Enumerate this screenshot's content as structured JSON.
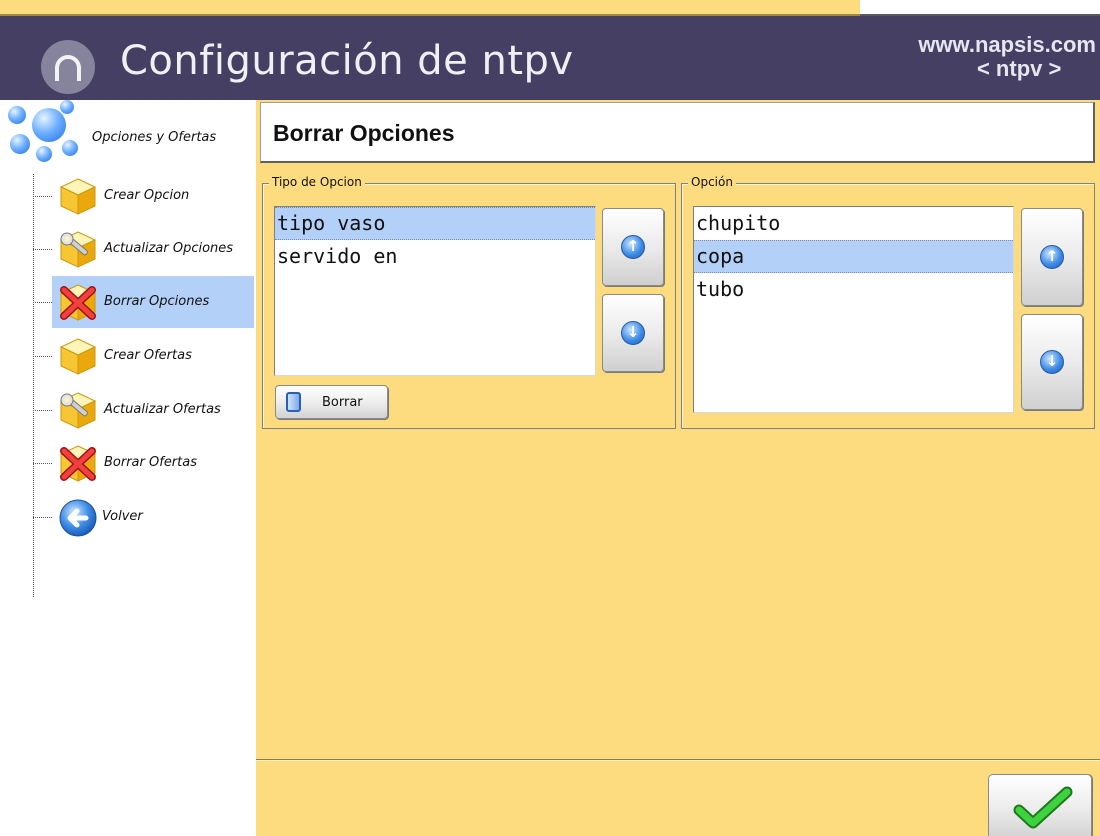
{
  "header": {
    "title": "Configuración de ntpv",
    "site_url": "www.napsis.com",
    "site_sub": "< ntpv >",
    "logo_icon": "ntpv-logo-icon",
    "colors": {
      "header_bg": "#453f63",
      "panel_bg": "#fddc80",
      "selection": "#b2d0f8"
    }
  },
  "sidebar": {
    "root_label": "Opciones y Ofertas",
    "root_icon": "bubbles-icon",
    "items": [
      {
        "label": "Crear Opcion",
        "icon": "cube-icon",
        "selected": false
      },
      {
        "label": "Actualizar Opciones",
        "icon": "wrench-cube-icon",
        "selected": false
      },
      {
        "label": "Borrar Opciones",
        "icon": "delete-cube-icon",
        "selected": true
      },
      {
        "label": "Crear Ofertas",
        "icon": "cube-icon",
        "selected": false
      },
      {
        "label": "Actualizar Ofertas",
        "icon": "wrench-cube-icon",
        "selected": false
      },
      {
        "label": "Borrar Ofertas",
        "icon": "delete-cube-icon",
        "selected": false
      },
      {
        "label": "Volver",
        "icon": "back-arrow-icon",
        "selected": false
      }
    ]
  },
  "main": {
    "title": "Borrar Opciones",
    "tipo_group": {
      "label": "Tipo de Opcion",
      "items": [
        {
          "text": "tipo vaso",
          "selected": true
        },
        {
          "text": "servido en",
          "selected": false
        }
      ]
    },
    "opcion_group": {
      "label": "Opción",
      "items": [
        {
          "text": "chupito",
          "selected": false
        },
        {
          "text": "copa",
          "selected": true
        },
        {
          "text": "tubo",
          "selected": false
        }
      ]
    },
    "delete_button": {
      "label": "Borrar",
      "icon": "trash-bin-icon"
    },
    "confirm_icon": "checkmark-icon"
  }
}
